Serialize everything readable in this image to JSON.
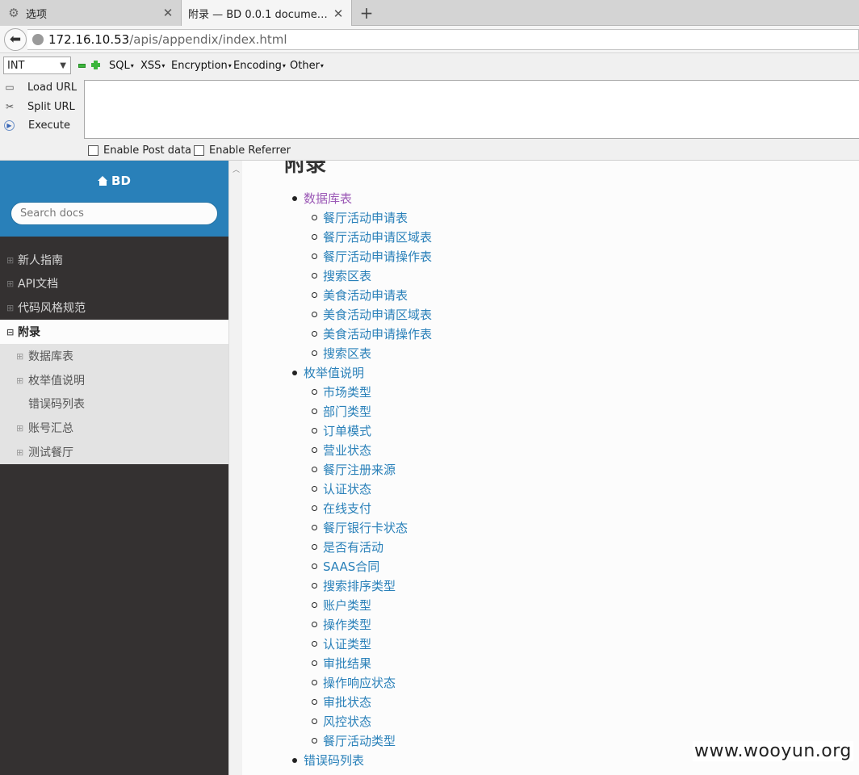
{
  "browser": {
    "tabs": [
      {
        "title": "选项",
        "icon": "gear-icon",
        "active": false
      },
      {
        "title": "附录 — BD 0.0.1 documenta...",
        "icon": "",
        "active": true
      }
    ],
    "url_host": "172.16.10.53",
    "url_path": "/apis/appendix/index.html"
  },
  "hackbar": {
    "select_value": "INT",
    "menus": [
      "SQL",
      "XSS",
      "Encryption",
      "Encoding",
      "Other"
    ],
    "actions": [
      "Load URL",
      "Split URL",
      "Execute"
    ],
    "checkboxes": [
      "Enable Post data",
      "Enable Referrer"
    ]
  },
  "sidebar": {
    "brand": "BD",
    "search_placeholder": "Search docs",
    "nav": [
      "新人指南",
      "API文档",
      "代码风格规范",
      "附录"
    ],
    "current": "附录",
    "sub": [
      "数据库表",
      "枚举值说明",
      "错误码列表",
      "账号汇总",
      "测试餐厅"
    ]
  },
  "content": {
    "title": "附录",
    "toc": [
      {
        "label": "数据库表",
        "children": [
          "餐厅活动申请表",
          "餐厅活动申请区域表",
          "餐厅活动申请操作表",
          "搜索区表",
          "美食活动申请表",
          "美食活动申请区域表",
          "美食活动申请操作表",
          "搜索区表"
        ]
      },
      {
        "label": "枚举值说明",
        "children": [
          "市场类型",
          "部门类型",
          "订单模式",
          "营业状态",
          "餐厅注册来源",
          "认证状态",
          "在线支付",
          "餐厅银行卡状态",
          "是否有活动",
          "SAAS合同",
          "搜索排序类型",
          "账户类型",
          "操作类型",
          "认证类型",
          "审批结果",
          "操作响应状态",
          "审批状态",
          "风控状态",
          "餐厅活动类型"
        ]
      },
      {
        "label": "错误码列表",
        "children": []
      }
    ]
  },
  "watermark": "www.wooyun.org",
  "colors": {
    "accent": "#2980b9",
    "visited": "#9b59b6",
    "sidebar_bg": "#343131"
  }
}
